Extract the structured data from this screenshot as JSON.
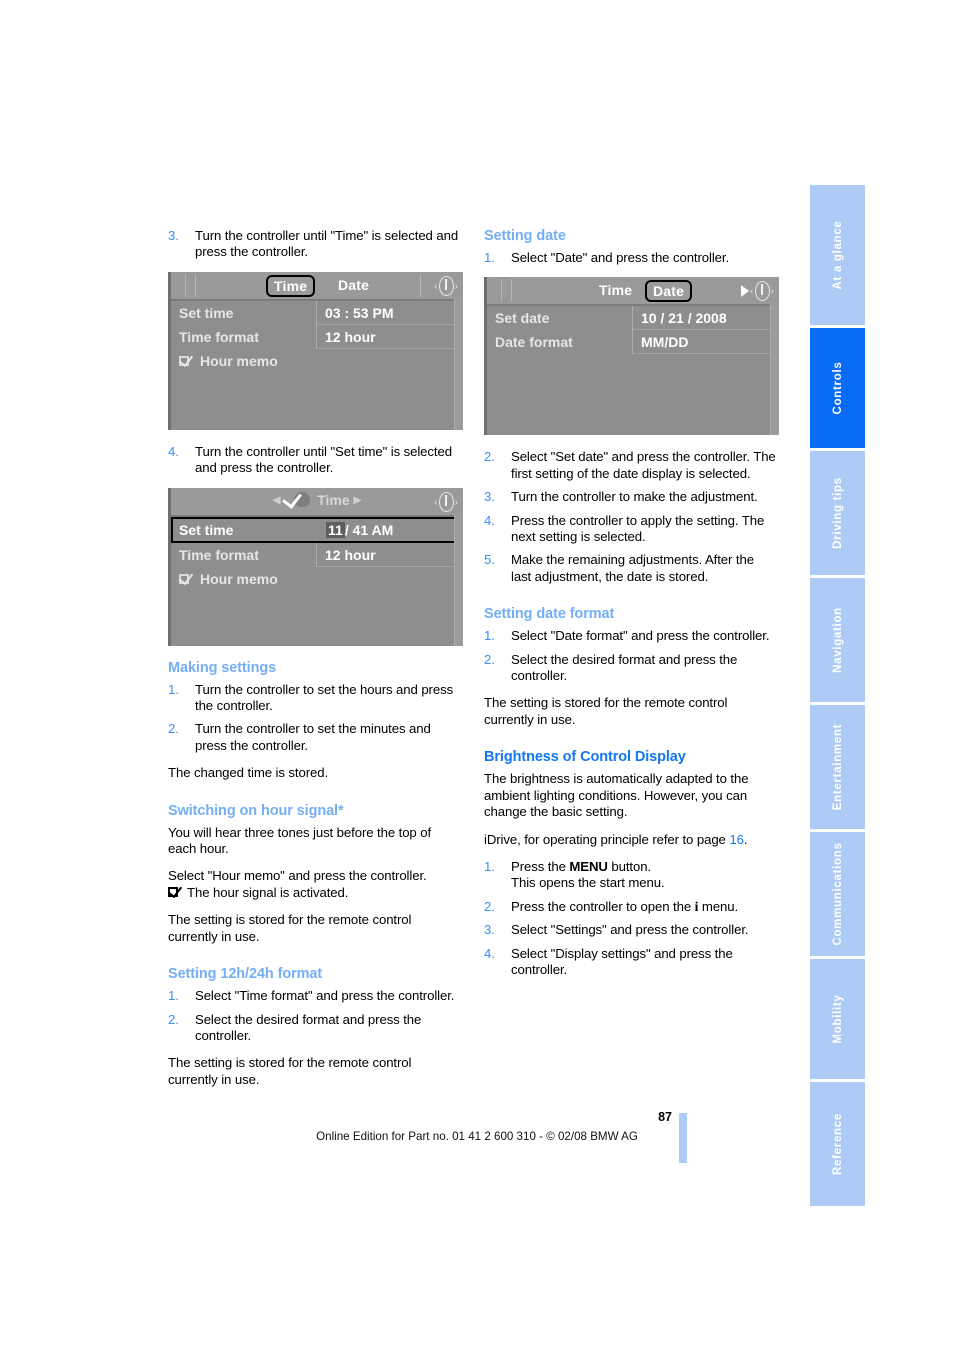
{
  "page": {
    "number": "87",
    "footer": "Online Edition for Part no. 01 41 2 600 310 - © 02/08 BMW AG"
  },
  "tab_rail": {
    "items": [
      {
        "label": "At a glance",
        "active": false
      },
      {
        "label": "Controls",
        "active": true
      },
      {
        "label": "Driving tips",
        "active": false
      },
      {
        "label": "Navigation",
        "active": false
      },
      {
        "label": "Entertainment",
        "active": false
      },
      {
        "label": "Communications",
        "active": false
      },
      {
        "label": "Mobility",
        "active": false
      },
      {
        "label": "Reference",
        "active": false
      }
    ],
    "colors": {
      "active": "#0a6bf7",
      "inactive": "#aecbf5",
      "text": "#ffffff"
    }
  },
  "left_column": {
    "step3": {
      "num": "3.",
      "text": "Turn the controller until \"Time\" is selected and press the controller."
    },
    "shot_time": {
      "tab_time": "Time",
      "tab_date": "Date",
      "rows": [
        {
          "label": "Set time",
          "value": "03 : 53 PM"
        },
        {
          "label": "Time format",
          "value": "12 hour"
        }
      ],
      "checkbox_row": "Hour memo"
    },
    "step4": {
      "num": "4.",
      "text": "Turn the controller until \"Set time\" is selected and press the controller."
    },
    "shot_settime": {
      "header_title": "Time",
      "rows": [
        {
          "label": "Set time",
          "value_sel": "11",
          "value_rest": "/ 41 AM"
        },
        {
          "label": "Time format",
          "value": "12 hour"
        }
      ],
      "checkbox_row": "Hour memo"
    },
    "making_settings": {
      "heading": "Making settings",
      "steps": [
        {
          "num": "1.",
          "text": "Turn the controller to set the hours and press the controller."
        },
        {
          "num": "2.",
          "text": "Turn the controller to set the minutes and press the controller."
        }
      ],
      "note": "The changed time is stored."
    },
    "hour_signal": {
      "heading": "Switching on hour signal*",
      "para1": "You will hear three tones just before the top of each hour.",
      "para2": "Select \"Hour memo\" and press the controller.",
      "checkbox_note": "The hour signal is activated.",
      "para3": "The setting is stored for the remote control currently in use."
    },
    "format_12_24": {
      "heading": "Setting 12h/24h format",
      "steps": [
        {
          "num": "1.",
          "text": "Select \"Time format\" and press the controller."
        },
        {
          "num": "2.",
          "text": "Select the desired format and press the controller."
        }
      ],
      "note": "The setting is stored for the remote control currently in use."
    }
  },
  "right_column": {
    "setting_date": {
      "heading": "Setting date",
      "step1": {
        "num": "1.",
        "text": "Select \"Date\" and press the controller."
      },
      "shot_date": {
        "tab_time": "Time",
        "tab_date": "Date",
        "rows": [
          {
            "label": "Set date",
            "value": "10 / 21 / 2008"
          },
          {
            "label": "Date format",
            "value": "MM/DD"
          }
        ]
      },
      "steps": [
        {
          "num": "2.",
          "text": "Select \"Set date\" and press the controller. The first setting of the date display is selected."
        },
        {
          "num": "3.",
          "text": "Turn the controller to make the adjustment."
        },
        {
          "num": "4.",
          "text": "Press the controller to apply the setting. The next setting is selected."
        },
        {
          "num": "5.",
          "text": "Make the remaining adjustments. After the last adjustment, the date is stored."
        }
      ]
    },
    "date_format": {
      "heading": "Setting date format",
      "steps": [
        {
          "num": "1.",
          "text": "Select \"Date format\" and press the controller."
        },
        {
          "num": "2.",
          "text": "Select the desired format and press the controller."
        }
      ],
      "note": "The setting is stored for the remote control currently in use."
    },
    "brightness": {
      "heading": "Brightness of Control Display",
      "para1": "The brightness is automatically adapted to the ambient lighting conditions. However, you can change the basic setting.",
      "idrive_prefix": "iDrive, for operating principle refer to page ",
      "idrive_page": "16",
      "idrive_suffix": ".",
      "steps": [
        {
          "num": "1.",
          "pre": "Press the ",
          "bold": "MENU",
          "post": " button.",
          "second_line": "This opens the start menu."
        },
        {
          "num": "2.",
          "pre": "Press the controller to open the ",
          "icon": "i",
          "post": " menu."
        },
        {
          "num": "3.",
          "text": "Select \"Settings\" and press the controller."
        },
        {
          "num": "4.",
          "text": "Select \"Display settings\" and press the controller."
        }
      ]
    }
  }
}
